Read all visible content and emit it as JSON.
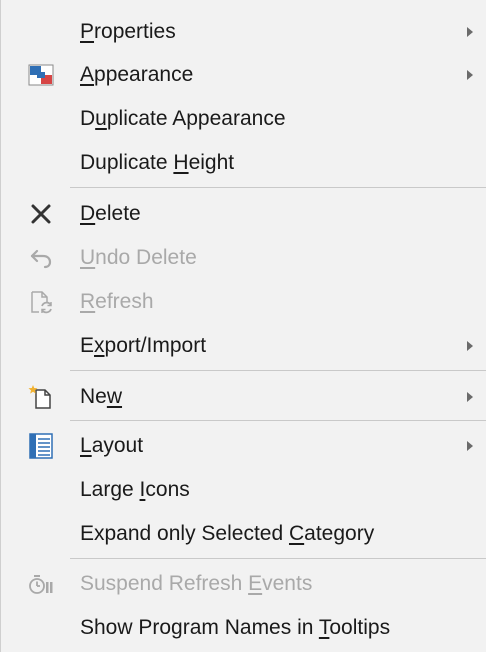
{
  "menu": {
    "items": [
      {
        "pre": "",
        "key": "P",
        "post": "roperties",
        "submenu": true,
        "disabled": false,
        "icon": "none"
      },
      {
        "pre": "",
        "key": "A",
        "post": "ppearance",
        "submenu": true,
        "disabled": false,
        "icon": "appearance-icon"
      },
      {
        "pre": "D",
        "key": "u",
        "post": "plicate Appearance",
        "submenu": false,
        "disabled": false,
        "icon": "none"
      },
      {
        "pre": "Duplicate ",
        "key": "H",
        "post": "eight",
        "submenu": false,
        "disabled": false,
        "icon": "none"
      },
      {
        "pre": "",
        "key": "D",
        "post": "elete",
        "submenu": false,
        "disabled": false,
        "icon": "delete-icon"
      },
      {
        "pre": "",
        "key": "U",
        "post": "ndo Delete",
        "submenu": false,
        "disabled": true,
        "icon": "undo-icon"
      },
      {
        "pre": "",
        "key": "R",
        "post": "efresh",
        "submenu": false,
        "disabled": true,
        "icon": "refresh-icon"
      },
      {
        "pre": "E",
        "key": "x",
        "post": "port/Import",
        "submenu": true,
        "disabled": false,
        "icon": "none"
      },
      {
        "pre": "Ne",
        "key": "w",
        "post": "",
        "submenu": true,
        "disabled": false,
        "icon": "new-icon"
      },
      {
        "pre": "",
        "key": "L",
        "post": "ayout",
        "submenu": true,
        "disabled": false,
        "icon": "layout-icon"
      },
      {
        "pre": "Large ",
        "key": "I",
        "post": "cons",
        "submenu": false,
        "disabled": false,
        "icon": "none"
      },
      {
        "pre": "Expand only Selected ",
        "key": "C",
        "post": "ategory",
        "submenu": false,
        "disabled": false,
        "icon": "none"
      },
      {
        "pre": "Suspend Refresh ",
        "key": "E",
        "post": "vents",
        "submenu": false,
        "disabled": true,
        "icon": "suspend-refresh-icon"
      },
      {
        "pre": "Show Program Names in ",
        "key": "T",
        "post": "ooltips",
        "submenu": false,
        "disabled": false,
        "icon": "none"
      }
    ]
  },
  "colors": {
    "background": "#f2f2f2",
    "text": "#1a1a1a",
    "disabled_text": "#a9a9a9",
    "separator": "#c9c9c9",
    "icon_blue": "#2f6fb5",
    "icon_red": "#d64545"
  }
}
